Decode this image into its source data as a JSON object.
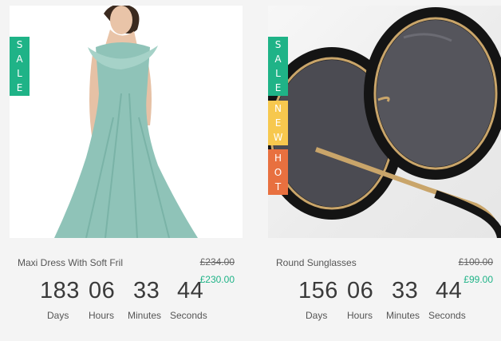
{
  "products": [
    {
      "tags": [
        {
          "type": "sale",
          "letters": [
            "S",
            "A",
            "L",
            "E"
          ],
          "color": "#1fb387"
        }
      ],
      "image_icon": "dress-photo",
      "name": "Maxi Dress With Soft Fril",
      "old_price": "£234.00",
      "new_price": "£230.00",
      "countdown": {
        "days": "183",
        "hours": "06",
        "minutes": "33",
        "seconds": "44",
        "days_label": "Days",
        "hours_label": "Hours",
        "minutes_label": "Minutes",
        "seconds_label": "Seconds"
      }
    },
    {
      "tags": [
        {
          "type": "sale",
          "letters": [
            "S",
            "A",
            "L",
            "E"
          ],
          "color": "#1fb387"
        },
        {
          "type": "new",
          "letters": [
            "N",
            "E",
            "W"
          ],
          "color": "#f7c84e"
        },
        {
          "type": "hot",
          "letters": [
            "H",
            "O",
            "T"
          ],
          "color": "#e8703f"
        }
      ],
      "image_icon": "sunglasses-photo",
      "name": "Round Sunglasses",
      "old_price": "£100.00",
      "new_price": "£99.00",
      "countdown": {
        "days": "156",
        "hours": "06",
        "minutes": "33",
        "seconds": "44",
        "days_label": "Days",
        "hours_label": "Hours",
        "minutes_label": "Minutes",
        "seconds_label": "Seconds"
      }
    }
  ]
}
